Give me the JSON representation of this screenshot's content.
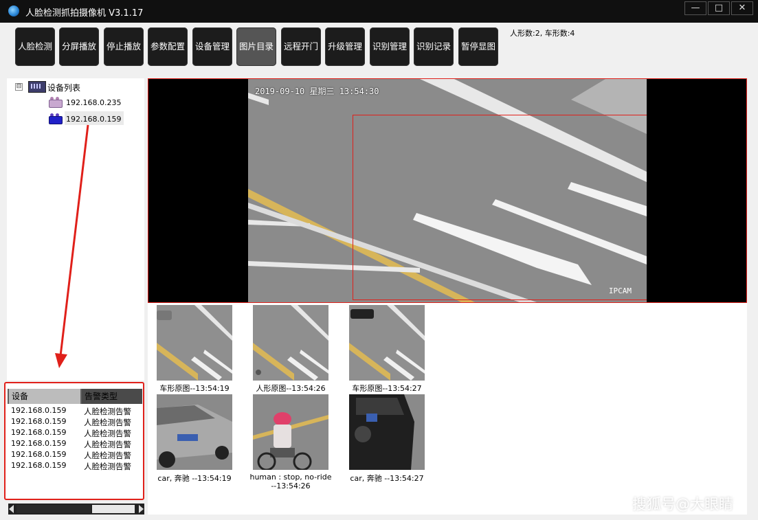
{
  "window": {
    "title": "人脸检测抓拍摄像机  V3.1.17",
    "min_icon": "minimize-icon",
    "max_icon": "maximize-icon",
    "close_icon": "close-icon"
  },
  "toolbar": {
    "buttons": [
      "人脸检测",
      "分屏播放",
      "停止播放",
      "参数配置",
      "设备管理",
      "图片目录",
      "远程开门",
      "升级管理",
      "识别管理",
      "识别记录",
      "暂停显图"
    ],
    "active_index": 5,
    "counts": "人形数:2, 车形数:4"
  },
  "device_tree": {
    "root_label": "设备列表",
    "expander": "⊟",
    "devices": [
      {
        "ip": "192.168.0.235",
        "icon": "camera-offline-icon"
      },
      {
        "ip": "192.168.0.159",
        "icon": "camera-online-icon"
      }
    ]
  },
  "alarm_list": {
    "headers": [
      "设备",
      "告警类型"
    ],
    "rows": [
      [
        "192.168.0.159",
        "人脸检测告警"
      ],
      [
        "192.168.0.159",
        "人脸检测告警"
      ],
      [
        "192.168.0.159",
        "人脸检测告警"
      ],
      [
        "192.168.0.159",
        "人脸检测告警"
      ],
      [
        "192.168.0.159",
        "人脸检测告警"
      ],
      [
        "192.168.0.159",
        "人脸检测告警"
      ]
    ]
  },
  "video": {
    "timestamp": "2019-09-10 星期三 13:54:30",
    "overlay_label": "IPCAM"
  },
  "captures": {
    "originals": [
      {
        "caption": "车形原图--13:54:19"
      },
      {
        "caption": "人形原图--13:54:26"
      },
      {
        "caption": "车形原图--13:54:27"
      }
    ],
    "crops": [
      {
        "caption": "car, 奔驰 --13:54:19"
      },
      {
        "caption_line1": "human : stop, no-ride",
        "caption_line2": "--13:54:26"
      },
      {
        "caption": "car, 奔驰 --13:54:27"
      }
    ]
  },
  "watermark": "搜狐号@大眼睛",
  "colors": {
    "highlight_red": "#e0201a",
    "toolbar_button": "#1c1c1c",
    "title_bar": "#101010"
  }
}
